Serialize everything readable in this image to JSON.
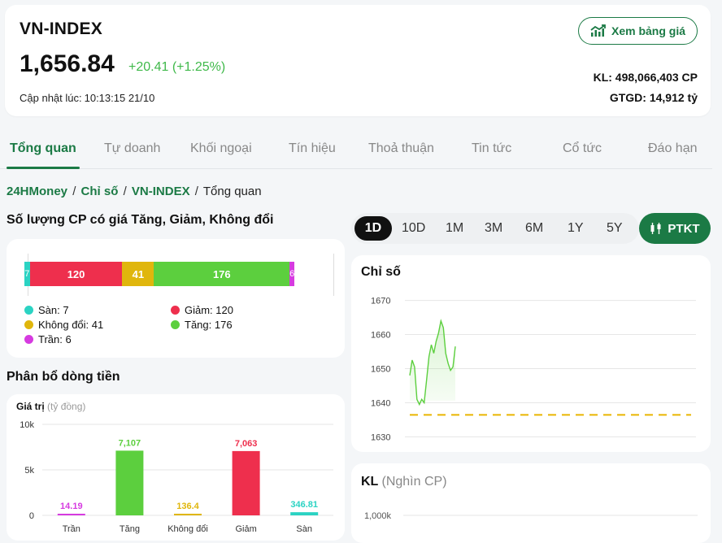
{
  "header": {
    "index_name": "VN-INDEX",
    "value": "1,656.84",
    "change": "+20.41 (+1.25%)",
    "updated_label": "Cập nhật lúc:",
    "updated_time": "10:13:15 21/10",
    "button_label": "Xem bảng giá",
    "kl": "KL: 498,066,403 CP",
    "gtgd": "GTGD: 14,912 tỷ",
    "up_color": "#3fb94a",
    "brand_color": "#1b7a45"
  },
  "tabs": [
    "Tổng quan",
    "Tự doanh",
    "Khối ngoại",
    "Tín hiệu",
    "Thoả thuận",
    "Tin tức",
    "Cổ tức",
    "Đáo hạn"
  ],
  "breadcrumb": {
    "home": "24HMoney",
    "sep": "/",
    "level1": "Chỉ số",
    "level2": "VN-INDEX",
    "current": "Tổng quan"
  },
  "counts": {
    "title": "Số lượng CP có giá Tăng, Giảm, Không đổi",
    "segments": [
      {
        "key": "san",
        "value": 7,
        "label": "7",
        "color": "#2bd3c3"
      },
      {
        "key": "giam",
        "value": 120,
        "label": "120",
        "color": "#ee2f4d"
      },
      {
        "key": "khongdoi",
        "value": 41,
        "label": "41",
        "color": "#e0b60c"
      },
      {
        "key": "tang",
        "value": 176,
        "label": "176",
        "color": "#5ccf3e"
      },
      {
        "key": "tran",
        "value": 6,
        "label": "6",
        "color": "#d63be0"
      }
    ],
    "legend": {
      "san": "Sàn: 7",
      "giam": "Giảm: 120",
      "khongdoi": "Không đổi: 41",
      "tang": "Tăng: 176",
      "tran": "Trần: 6"
    }
  },
  "flow": {
    "title": "Phân bổ dòng tiền",
    "ylabel": "Giá trị",
    "yunit": "(tỷ đồng)",
    "yticks": [
      "10k",
      "5k",
      "0"
    ],
    "ymax": 10000
  },
  "ranges": [
    "1D",
    "10D",
    "1M",
    "3M",
    "6M",
    "1Y",
    "5Y"
  ],
  "ptkt_label": "PTKT",
  "index_chart": {
    "title": "Chỉ số",
    "yticks": [
      "1670",
      "1660",
      "1650",
      "1640",
      "1630"
    ]
  },
  "kl_chart": {
    "title": "KL",
    "unit": "(Nghìn CP)",
    "ytick": "1,000k"
  },
  "chart_data": [
    {
      "type": "bar",
      "title": "Phân bổ dòng tiền",
      "ylabel": "Giá trị (tỷ đồng)",
      "categories": [
        "Trần",
        "Tăng",
        "Không đổi",
        "Giảm",
        "Sàn"
      ],
      "values": [
        14.19,
        7107,
        136.4,
        7063,
        346.81
      ],
      "value_labels": [
        "14.19",
        "7,107",
        "136.4",
        "7,063",
        "346.81"
      ],
      "colors": [
        "#d63be0",
        "#5ccf3e",
        "#e0b60c",
        "#ee2f4d",
        "#2bd3c3"
      ],
      "ylim": [
        0,
        10000
      ]
    },
    {
      "type": "area",
      "title": "Chỉ số",
      "ylim": [
        1627,
        1673
      ],
      "reference": 1636.43,
      "y": [
        1648.0,
        1652.5,
        1650.5,
        1641.0,
        1639.5,
        1641.0,
        1640.0,
        1646.5,
        1653.5,
        1657.0,
        1654.5,
        1658.0,
        1660.5,
        1664.0,
        1662.0,
        1654.5,
        1651.5,
        1649.5,
        1650.5,
        1656.5
      ]
    }
  ]
}
